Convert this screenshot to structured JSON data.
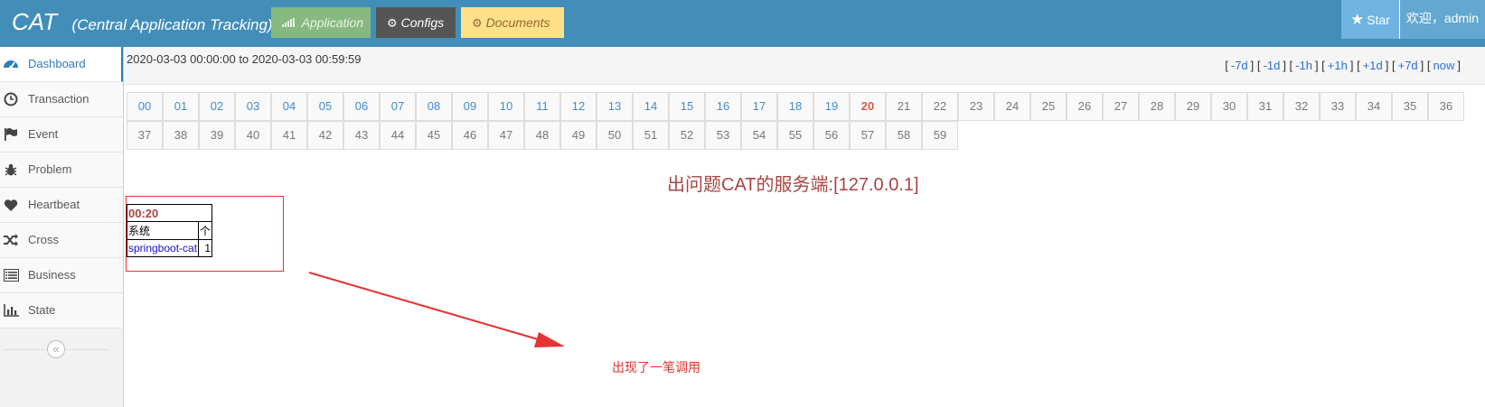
{
  "header": {
    "brand": "CAT",
    "subtitle": "(Central Application Tracking)",
    "buttons": [
      {
        "label": "Application",
        "icon": "bar-chart-icon"
      },
      {
        "label": "Configs",
        "icon": "cogs-icon"
      },
      {
        "label": "Documents",
        "icon": "cogs-icon"
      }
    ],
    "star_label": "Star",
    "user_label": "欢迎，admin"
  },
  "sidebar": {
    "items": [
      {
        "label": "Dashboard",
        "icon": "dashboard-icon"
      },
      {
        "label": "Transaction",
        "icon": "clock-icon"
      },
      {
        "label": "Event",
        "icon": "flag-icon"
      },
      {
        "label": "Problem",
        "icon": "bug-icon"
      },
      {
        "label": "Heartbeat",
        "icon": "heart-icon"
      },
      {
        "label": "Cross",
        "icon": "random-icon"
      },
      {
        "label": "Business",
        "icon": "list-icon"
      },
      {
        "label": "State",
        "icon": "bar-chart-icon"
      }
    ],
    "collapse_icon": "«"
  },
  "time_range": "2020-03-03 00:00:00 to 2020-03-03 00:59:59",
  "nav_links": [
    "-7d",
    "-1d",
    "-1h",
    "+1h",
    "+1d",
    "+7d",
    "now"
  ],
  "minutes": [
    "00",
    "01",
    "02",
    "03",
    "04",
    "05",
    "06",
    "07",
    "08",
    "09",
    "10",
    "11",
    "12",
    "13",
    "14",
    "15",
    "16",
    "17",
    "18",
    "19",
    "20",
    "21",
    "22",
    "23",
    "24",
    "25",
    "26",
    "27",
    "28",
    "29",
    "30",
    "31",
    "32",
    "33",
    "34",
    "35",
    "36",
    "37",
    "38",
    "39",
    "40",
    "41",
    "42",
    "43",
    "44",
    "45",
    "46",
    "47",
    "48",
    "49",
    "50",
    "51",
    "52",
    "53",
    "54",
    "55",
    "56",
    "57",
    "58",
    "59"
  ],
  "current_minute": "20",
  "problem_title": "出问题CAT的服务端:[127.0.0.1]",
  "problem_table": {
    "time": "00:20",
    "header_system": "系统",
    "header_count": "个",
    "row_system": "springboot-cat",
    "row_count": "1"
  },
  "annotation_note": "出现了一笔调用",
  "colors": {
    "navbar": "#438eb9",
    "accent": "#2b7dbc",
    "alert": "#e53333",
    "title": "#a94442"
  }
}
